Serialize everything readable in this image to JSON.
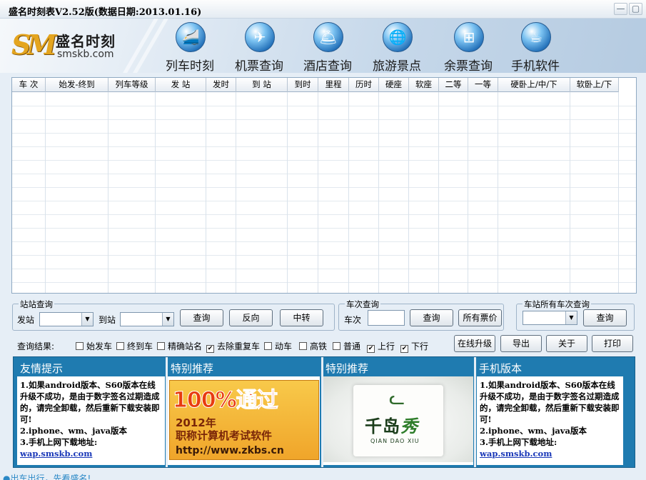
{
  "window": {
    "title": "盛名时刻表V2.52版(数据日期:2013.01.16)",
    "minimize_glyph": "—",
    "close_glyph": "▢"
  },
  "header": {
    "logo": {
      "mark": "SM",
      "name": "盛名时刻",
      "site": "smskb.com"
    },
    "nav": [
      {
        "label": "列车时刻",
        "icon": "train-icon",
        "glyph": "🚄"
      },
      {
        "label": "机票查询",
        "icon": "airplane-icon",
        "glyph": "✈"
      },
      {
        "label": "酒店查询",
        "icon": "hotel-bell-icon",
        "glyph": "🛎"
      },
      {
        "label": "旅游景点",
        "icon": "globe-icon",
        "glyph": "🌐"
      },
      {
        "label": "余票查询",
        "icon": "windows-icon",
        "glyph": "⊞"
      },
      {
        "label": "手机软件",
        "icon": "java-icon",
        "glyph": "☕"
      }
    ]
  },
  "grid": {
    "columns": [
      "车 次",
      "始发-终到",
      "列车等级",
      "发  站",
      "发时",
      "到  站",
      "到时",
      "里程",
      "历时",
      "硬座",
      "软座",
      "二等",
      "一等",
      "硬卧上/中/下",
      "软卧上/下"
    ],
    "rows": []
  },
  "station_query": {
    "legend": "站站查询",
    "from_label": "发站",
    "to_label": "到站",
    "from_value": "",
    "to_value": "",
    "query_button": "查询",
    "reverse_button": "反向",
    "transfer_button": "中转"
  },
  "train_query": {
    "legend": "车次查询",
    "train_label": "车次",
    "train_value": "",
    "query_button": "查询",
    "all_prices_button": "所有票价"
  },
  "station_trains_query": {
    "legend": "车站所有车次查询",
    "station_value": "",
    "query_button": "查询"
  },
  "filters": {
    "label": "查询结果:",
    "options": [
      {
        "label": "始发车",
        "checked": false
      },
      {
        "label": "终到车",
        "checked": false
      },
      {
        "label": "精确站名",
        "checked": false
      },
      {
        "label": "去除重复车",
        "checked": true
      },
      {
        "label": "动车",
        "checked": false
      },
      {
        "label": "高铁",
        "checked": false
      },
      {
        "label": "普通",
        "checked": false
      },
      {
        "label": "上行",
        "checked": true
      },
      {
        "label": "下行",
        "checked": true
      }
    ],
    "check_glyph": "✔"
  },
  "actions": {
    "online_upgrade": "在线升级",
    "export": "导出",
    "about": "关于",
    "print": "打印"
  },
  "panels": {
    "tips": {
      "title": "友情提示",
      "lines": [
        "1.如果android版本、S60版本在线升级不成功，是由于数字签名过期造成的，请完全卸载，然后重新下载安装即可!",
        "2.iphone、wm、java版本",
        "3.手机上网下载地址:"
      ],
      "link": "wap.smskb.com"
    },
    "recommend1": {
      "title": "特别推荐",
      "ad_big": "100%通过",
      "ad_year": "2012年",
      "ad_text": "职称计算机考试软件",
      "ad_url": "http://www.zkbs.cn"
    },
    "recommend2": {
      "title": "特别推荐",
      "brand_a": "千岛",
      "brand_b": "秀",
      "pinyin": "QIAN DAO XIU"
    },
    "mobile": {
      "title": "手机版本",
      "lines": [
        "1.如果android版本、S60版本在线升级不成功，是由于数字签名过期造成的，请完全卸载，然后重新下载安装即可!",
        "2.iphone、wm、java版本",
        "3.手机上网下载地址:"
      ],
      "link": "wap.smskb.com"
    }
  },
  "footer": {
    "text": "●出车出行，先看盛名!"
  },
  "colors": {
    "panel_blue": "#1f7bb0",
    "link_blue": "#1a38b8",
    "footer_blue": "#2a88c6"
  }
}
